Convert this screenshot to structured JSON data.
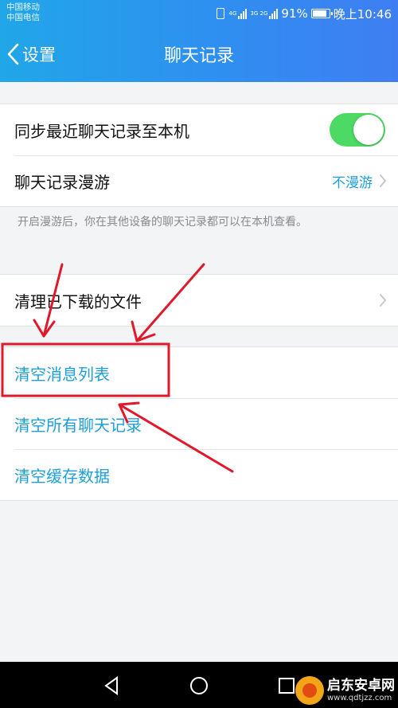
{
  "status_bar": {
    "carrier_1": "中国移动",
    "carrier_2": "中国电信",
    "network_top": "4G",
    "network_bottom": "3G 2G",
    "battery": "91%",
    "battery_level": 0.91,
    "time": "晚上10:46"
  },
  "title_bar": {
    "back_label": "设置",
    "title": "聊天记录"
  },
  "settings": {
    "sync_label": "同步最近聊天记录至本机",
    "sync_enabled": true,
    "roaming_label": "聊天记录漫游",
    "roaming_value": "不漫游",
    "roaming_hint": "开启漫游后，你在其他设备的聊天记录都可以在本机查看。",
    "clear_downloads_label": "清理已下载的文件"
  },
  "actions": {
    "clear_message_list": "清空消息列表",
    "clear_all_chats": "清空所有聊天记录",
    "clear_cache": "清空缓存数据"
  },
  "watermark": {
    "title": "启东安卓网",
    "url": "www.qdtjzz.com"
  },
  "colors": {
    "header_start": "#21a6e8",
    "header_end": "#3f7ef2",
    "toggle_on": "#4cd964",
    "link_blue": "#1e9fd8",
    "annotation_red": "#e0182a"
  }
}
